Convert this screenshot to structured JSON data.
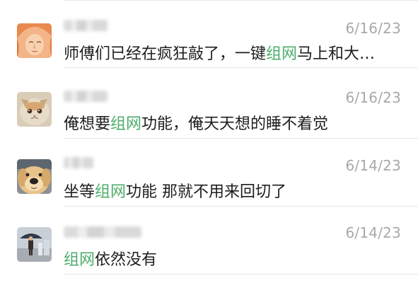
{
  "comments": [
    {
      "date": "6/16/23",
      "text_pre": "师傅们已经在疯狂敲了，一键",
      "keyword": "组网",
      "text_post": "马上和大…"
    },
    {
      "date": "6/16/23",
      "text_pre": "俺想要",
      "keyword": "组网",
      "text_post": "功能，俺天天想的睡不着觉"
    },
    {
      "date": "6/14/23",
      "text_pre": "坐等",
      "keyword": "组网",
      "text_post": "功能 那就不用来回切了"
    },
    {
      "date": "6/14/23",
      "text_pre": "",
      "keyword": "组网",
      "text_post": "依然没有"
    }
  ],
  "colors": {
    "keyword_highlight": "#4cac6b",
    "date_text": "#a9a9a9",
    "body_text": "#1d1d1d"
  }
}
